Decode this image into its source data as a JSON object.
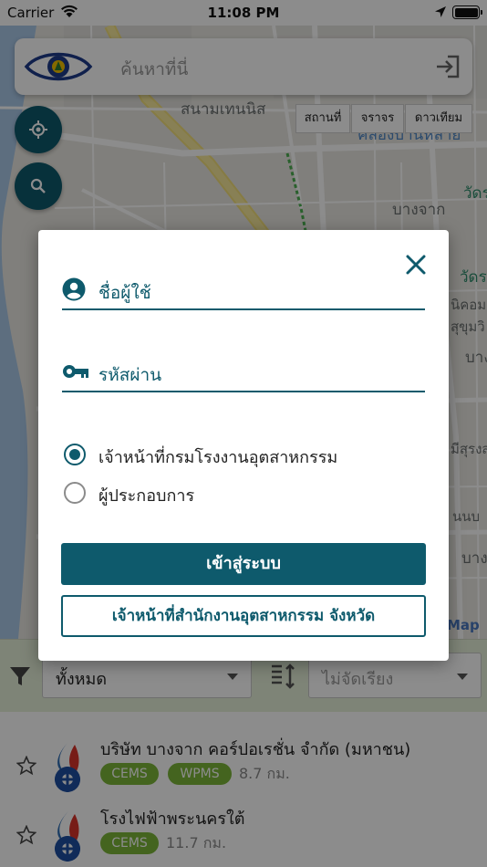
{
  "status_bar": {
    "carrier": "Carrier",
    "time": "11:08 PM"
  },
  "search": {
    "placeholder": "ค้นหาที่นี่"
  },
  "map": {
    "type_buttons": [
      "สถานที่",
      "จราจร",
      "ดาวเทียม"
    ],
    "labels": [
      "สนามเทนนิส",
      "คลองบ้านหลาย",
      "บางจาก",
      "วัดร",
      "วัดร",
      "นิคอม",
      "สุขุมวิ",
      "บางจ",
      "มีสุรงส",
      "นนบ",
      "บาง"
    ],
    "attribution": "Map",
    "brand_color": "#0e5a6c"
  },
  "filter": {
    "category": "ทั้งหมด",
    "sort": "ไม่จัดเรียง"
  },
  "list": [
    {
      "name": "บริษัท บางจาก คอร์ปอเรชั่น จำกัด (มหาชน)",
      "tags": [
        "CEMS",
        "WPMS"
      ],
      "distance": "8.7 กม."
    },
    {
      "name": "โรงไฟฟ้าพระนครใต้",
      "tags": [
        "CEMS"
      ],
      "distance": "11.7 กม."
    }
  ],
  "login_dialog": {
    "username_label": "ชื่อผู้ใช้",
    "password_label": "รหัสผ่าน",
    "role_options": [
      "เจ้าหน้าที่กรมโรงงานอุตสาหกรรม",
      "ผู้ประกอบการ"
    ],
    "selected_role": "เจ้าหน้าที่กรมโรงงานอุตสาหกรรม",
    "login_button": "เข้าสู่ระบบ",
    "provincial_button": "เจ้าหน้าที่สำนักงานอุตสาหกรรม จังหวัด"
  }
}
